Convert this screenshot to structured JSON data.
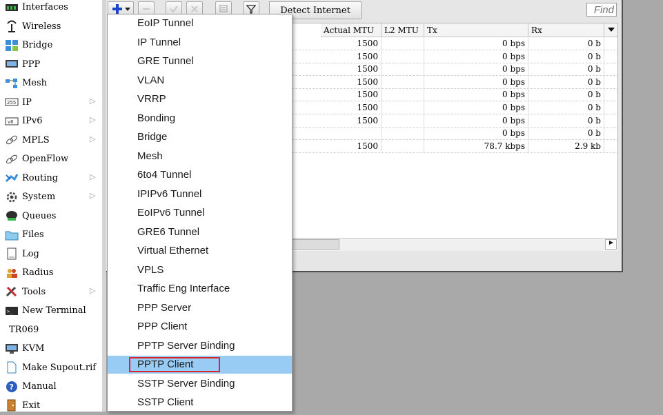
{
  "sidebar": {
    "items": [
      {
        "label": "Interfaces",
        "icon": "interfaces-icon",
        "submenu": false
      },
      {
        "label": "Wireless",
        "icon": "wireless-icon",
        "submenu": false
      },
      {
        "label": "Bridge",
        "icon": "bridge-icon",
        "submenu": false
      },
      {
        "label": "PPP",
        "icon": "ppp-icon",
        "submenu": false
      },
      {
        "label": "Mesh",
        "icon": "mesh-icon",
        "submenu": false
      },
      {
        "label": "IP",
        "icon": "ip-icon",
        "submenu": true
      },
      {
        "label": "IPv6",
        "icon": "ipv6-icon",
        "submenu": true
      },
      {
        "label": "MPLS",
        "icon": "mpls-icon",
        "submenu": true
      },
      {
        "label": "OpenFlow",
        "icon": "openflow-icon",
        "submenu": false
      },
      {
        "label": "Routing",
        "icon": "routing-icon",
        "submenu": true
      },
      {
        "label": "System",
        "icon": "system-gear-icon",
        "submenu": true
      },
      {
        "label": "Queues",
        "icon": "queues-icon",
        "submenu": false
      },
      {
        "label": "Files",
        "icon": "folder-icon",
        "submenu": false
      },
      {
        "label": "Log",
        "icon": "log-icon",
        "submenu": false
      },
      {
        "label": "Radius",
        "icon": "radius-users-icon",
        "submenu": false
      },
      {
        "label": "Tools",
        "icon": "tools-icon",
        "submenu": true
      },
      {
        "label": "New Terminal",
        "icon": "terminal-icon",
        "submenu": false
      },
      {
        "label": "TR069",
        "icon": "",
        "submenu": false
      },
      {
        "label": "KVM",
        "icon": "kvm-icon",
        "submenu": false
      },
      {
        "label": "Make Supout.rif",
        "icon": "document-icon",
        "submenu": false
      },
      {
        "label": "Manual",
        "icon": "help-icon",
        "submenu": false
      },
      {
        "label": "Exit",
        "icon": "exit-door-icon",
        "submenu": false
      }
    ]
  },
  "toolbar": {
    "detect_label": "Detect Internet",
    "find_placeholder": "Find"
  },
  "table": {
    "columns": [
      "Actual MTU",
      "L2 MTU",
      "Tx",
      "Rx"
    ],
    "rows": [
      {
        "actual_mtu": "1500",
        "l2_mtu": "",
        "tx": "0 bps",
        "rx": "0 b"
      },
      {
        "actual_mtu": "1500",
        "l2_mtu": "",
        "tx": "0 bps",
        "rx": "0 b"
      },
      {
        "actual_mtu": "1500",
        "l2_mtu": "",
        "tx": "0 bps",
        "rx": "0 b"
      },
      {
        "actual_mtu": "1500",
        "l2_mtu": "",
        "tx": "0 bps",
        "rx": "0 b"
      },
      {
        "actual_mtu": "1500",
        "l2_mtu": "",
        "tx": "0 bps",
        "rx": "0 b"
      },
      {
        "actual_mtu": "1500",
        "l2_mtu": "",
        "tx": "0 bps",
        "rx": "0 b"
      },
      {
        "actual_mtu": "1500",
        "l2_mtu": "",
        "tx": "0 bps",
        "rx": "0 b"
      },
      {
        "actual_mtu": "",
        "l2_mtu": "",
        "tx": "0 bps",
        "rx": "0 b"
      },
      {
        "actual_mtu": "1500",
        "l2_mtu": "",
        "tx": "78.7 kbps",
        "rx": "2.9 kb"
      }
    ]
  },
  "menu": {
    "items": [
      "EoIP Tunnel",
      "IP Tunnel",
      "GRE Tunnel",
      "VLAN",
      "VRRP",
      "Bonding",
      "Bridge",
      "Mesh",
      "6to4 Tunnel",
      "IPIPv6 Tunnel",
      "EoIPv6 Tunnel",
      "GRE6 Tunnel",
      "Virtual Ethernet",
      "VPLS",
      "Traffic Eng Interface",
      "PPP Server",
      "PPP Client",
      "PPTP Server Binding",
      "PPTP Client",
      "SSTP Server Binding",
      "SSTP Client"
    ],
    "highlighted": "PPTP Client",
    "highlight_color": "#99ccf5",
    "outline_color": "#d9262b"
  }
}
